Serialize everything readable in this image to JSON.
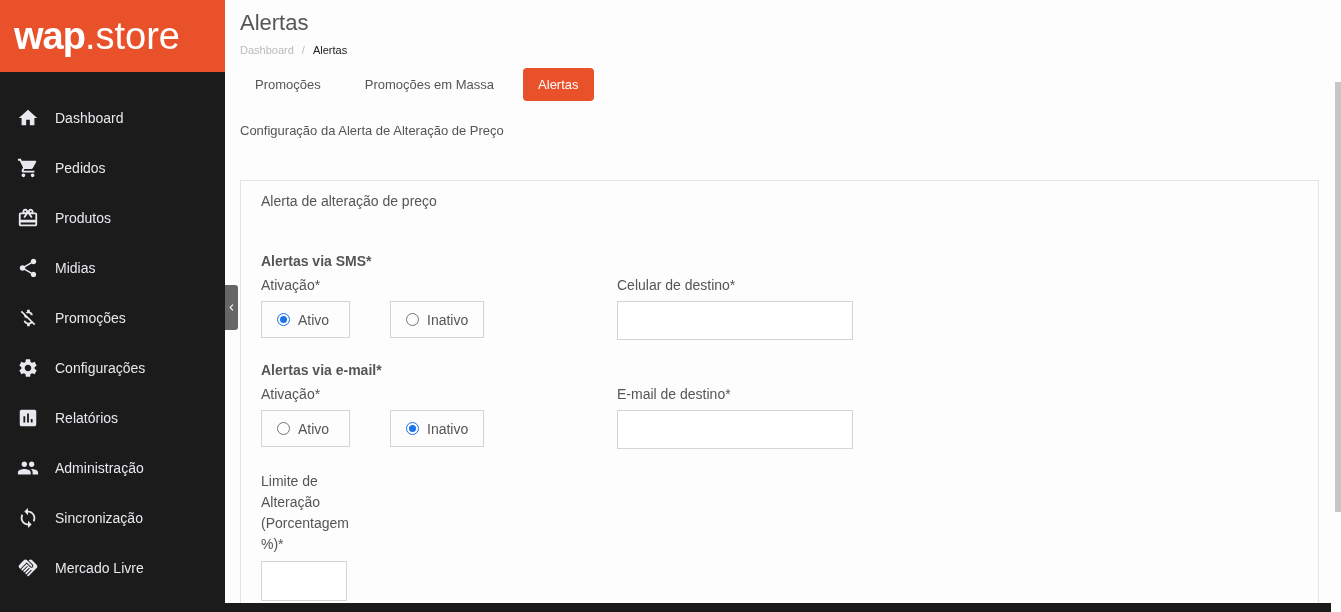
{
  "logo": {
    "brand": "wap",
    "suffix": ".store"
  },
  "sidebar": {
    "items": [
      {
        "label": "Dashboard"
      },
      {
        "label": "Pedidos"
      },
      {
        "label": "Produtos"
      },
      {
        "label": "Midias"
      },
      {
        "label": "Promoções"
      },
      {
        "label": "Configurações"
      },
      {
        "label": "Relatórios"
      },
      {
        "label": "Administração"
      },
      {
        "label": "Sincronização"
      },
      {
        "label": "Mercado Livre"
      }
    ]
  },
  "page": {
    "title": "Alertas",
    "breadcrumb_separator": "/",
    "breadcrumb": [
      {
        "label": "Dashboard",
        "current": false
      },
      {
        "label": "Alertas",
        "current": true
      }
    ]
  },
  "tabs": [
    {
      "label": "Promoções",
      "selected": false
    },
    {
      "label": "Promoções em Massa",
      "selected": false
    },
    {
      "label": "Alertas",
      "selected": true
    }
  ],
  "subtitle": "Configuração da Alerta de Alteração de Preço",
  "card": {
    "title": "Alerta de alteração de preço",
    "sections": [
      {
        "heading": "Alertas via SMS*",
        "activation_label": "Ativação*",
        "options": [
          {
            "label": "Ativo",
            "selected": true
          },
          {
            "label": "Inativo",
            "selected": false
          }
        ],
        "field_label": "Celular de destino*"
      },
      {
        "heading": "Alertas via e-mail*",
        "activation_label": "Ativação*",
        "options": [
          {
            "label": "Ativo",
            "selected": false
          },
          {
            "label": "Inativo",
            "selected": true
          }
        ],
        "field_label": "E-mail de destino*"
      }
    ],
    "limit_label": "Limite de Alteração (Porcentagem %)*"
  }
}
